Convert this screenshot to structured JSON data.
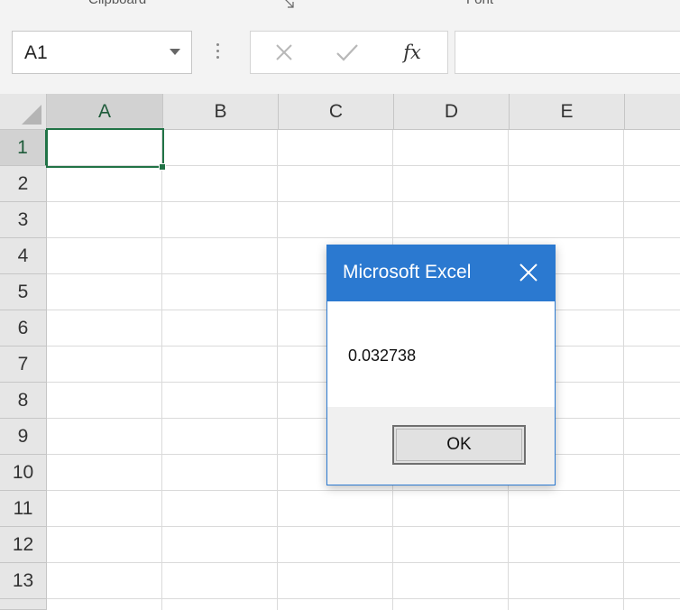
{
  "ribbon": {
    "groups": [
      "Clipboard",
      "Font"
    ]
  },
  "formula_bar": {
    "name_box_value": "A1",
    "cancel_icon": "close-icon",
    "enter_icon": "checkmark-icon",
    "function_label": "fx",
    "formula_value": ""
  },
  "sheet": {
    "columns": [
      "A",
      "B",
      "C",
      "D",
      "E"
    ],
    "rows": [
      "1",
      "2",
      "3",
      "4",
      "5",
      "6",
      "7",
      "8",
      "9",
      "10",
      "11",
      "12",
      "13"
    ],
    "active_cell": "A1"
  },
  "dialog": {
    "title": "Microsoft Excel",
    "message": "0.032738",
    "ok_label": "OK"
  },
  "colors": {
    "selection_green": "#217346",
    "dialog_blue": "#2b79d0"
  }
}
